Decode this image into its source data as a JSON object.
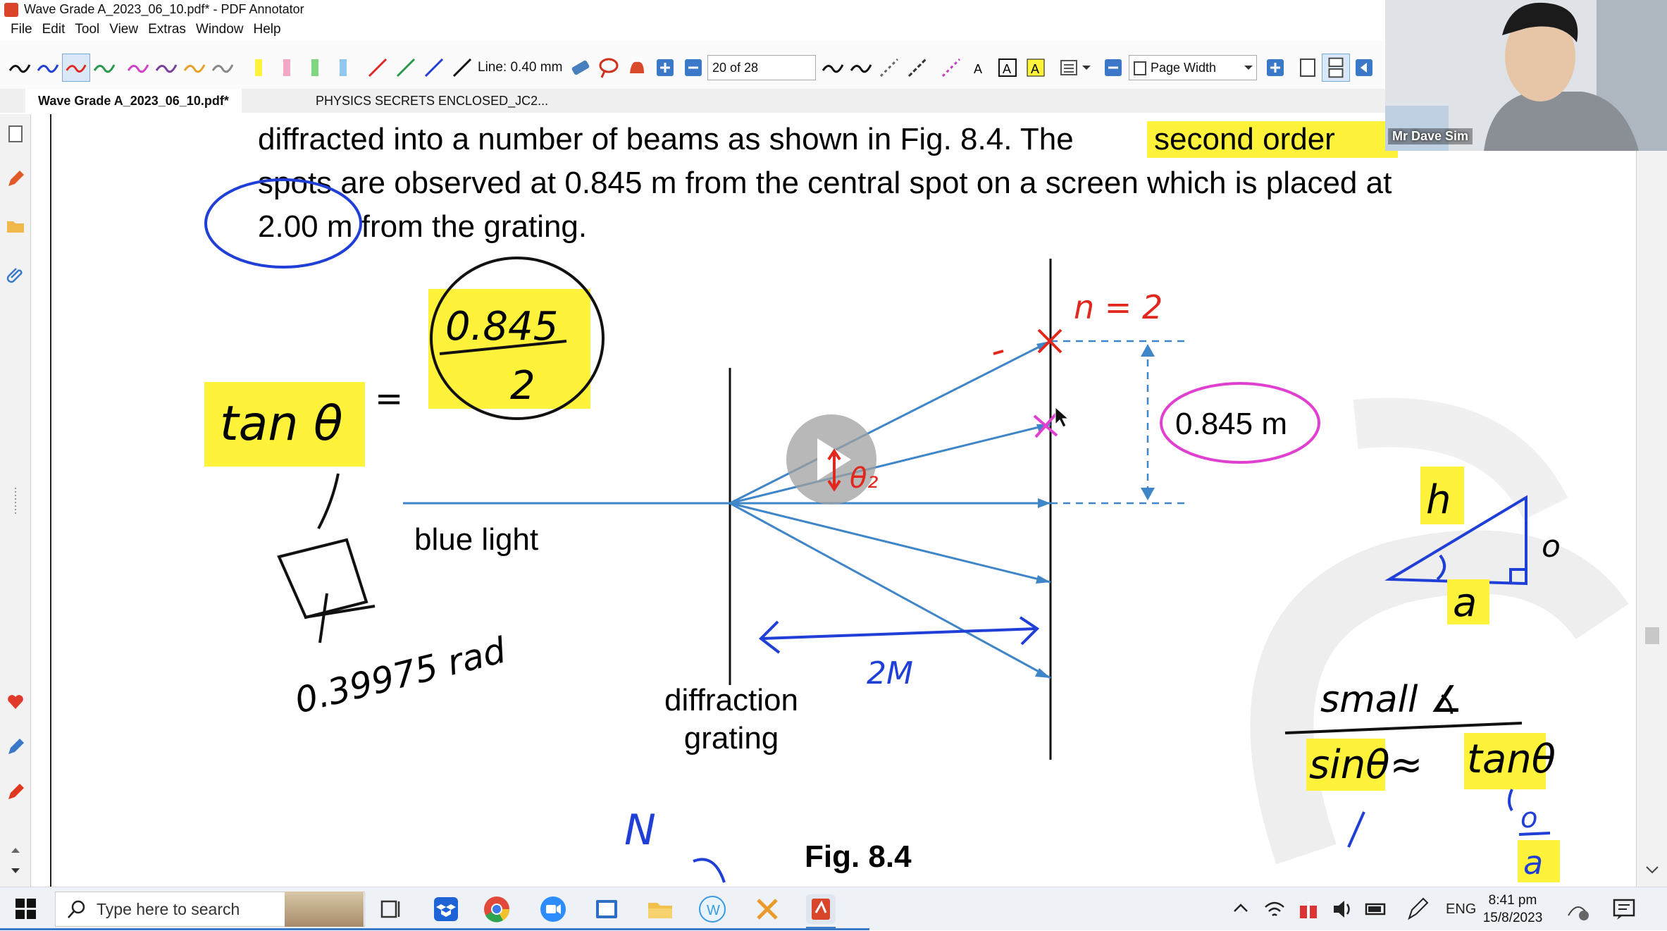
{
  "window": {
    "title": "Wave Grade A_2023_06_10.pdf* - PDF Annotator"
  },
  "menu": [
    "File",
    "Edit",
    "Tool",
    "View",
    "Extras",
    "Window",
    "Help"
  ],
  "toolbar": {
    "line_label": "Line: 0.40 mm",
    "page_field": "20 of 28",
    "zoom_select": "Page Width"
  },
  "tabs": [
    {
      "label": "Wave Grade A_2023_06_10.pdf*",
      "active": true
    },
    {
      "label": "PHYSICS SECRETS ENCLOSED_JC2...",
      "active": false
    }
  ],
  "document": {
    "line1_a": "diffracted into a number of beams as shown in Fig. 8.4. The",
    "line1_hl": "second order",
    "line2": "spots are observed at 0.845 m from the central spot on a screen which is placed at",
    "line3": "2.00 m from the grating.",
    "label_blue_light": "blue light",
    "label_diffraction": "diffraction",
    "label_grating": "grating",
    "label_distance": "0.845 m",
    "fig_caption": "Fig. 8.4"
  },
  "annotations": {
    "tan": "tan θ",
    "equals": "=",
    "frac_num": "0.845",
    "frac_den": "2",
    "result": "0.39975 rad",
    "n2": "n = 2",
    "theta2": "θ₂",
    "two_m": "2M",
    "small": "small ∡",
    "sin_approx": "sinθ≈",
    "tan2": "tanθ",
    "h": "h",
    "o": "o",
    "a": "a",
    "o2": "o",
    "a2": "a",
    "N": "N"
  },
  "video": {
    "name": "Mr Dave Sim"
  },
  "taskbar": {
    "search_placeholder": "Type here to search",
    "lang": "ENG",
    "time": "8:41 pm",
    "date": "15/8/2023"
  },
  "colors": {
    "highlight": "#fff23a",
    "ink_blue": "#1f3fd6",
    "ink_red": "#e0281e",
    "ink_magenta": "#e040d0",
    "diagram_blue": "#3f86c8"
  }
}
